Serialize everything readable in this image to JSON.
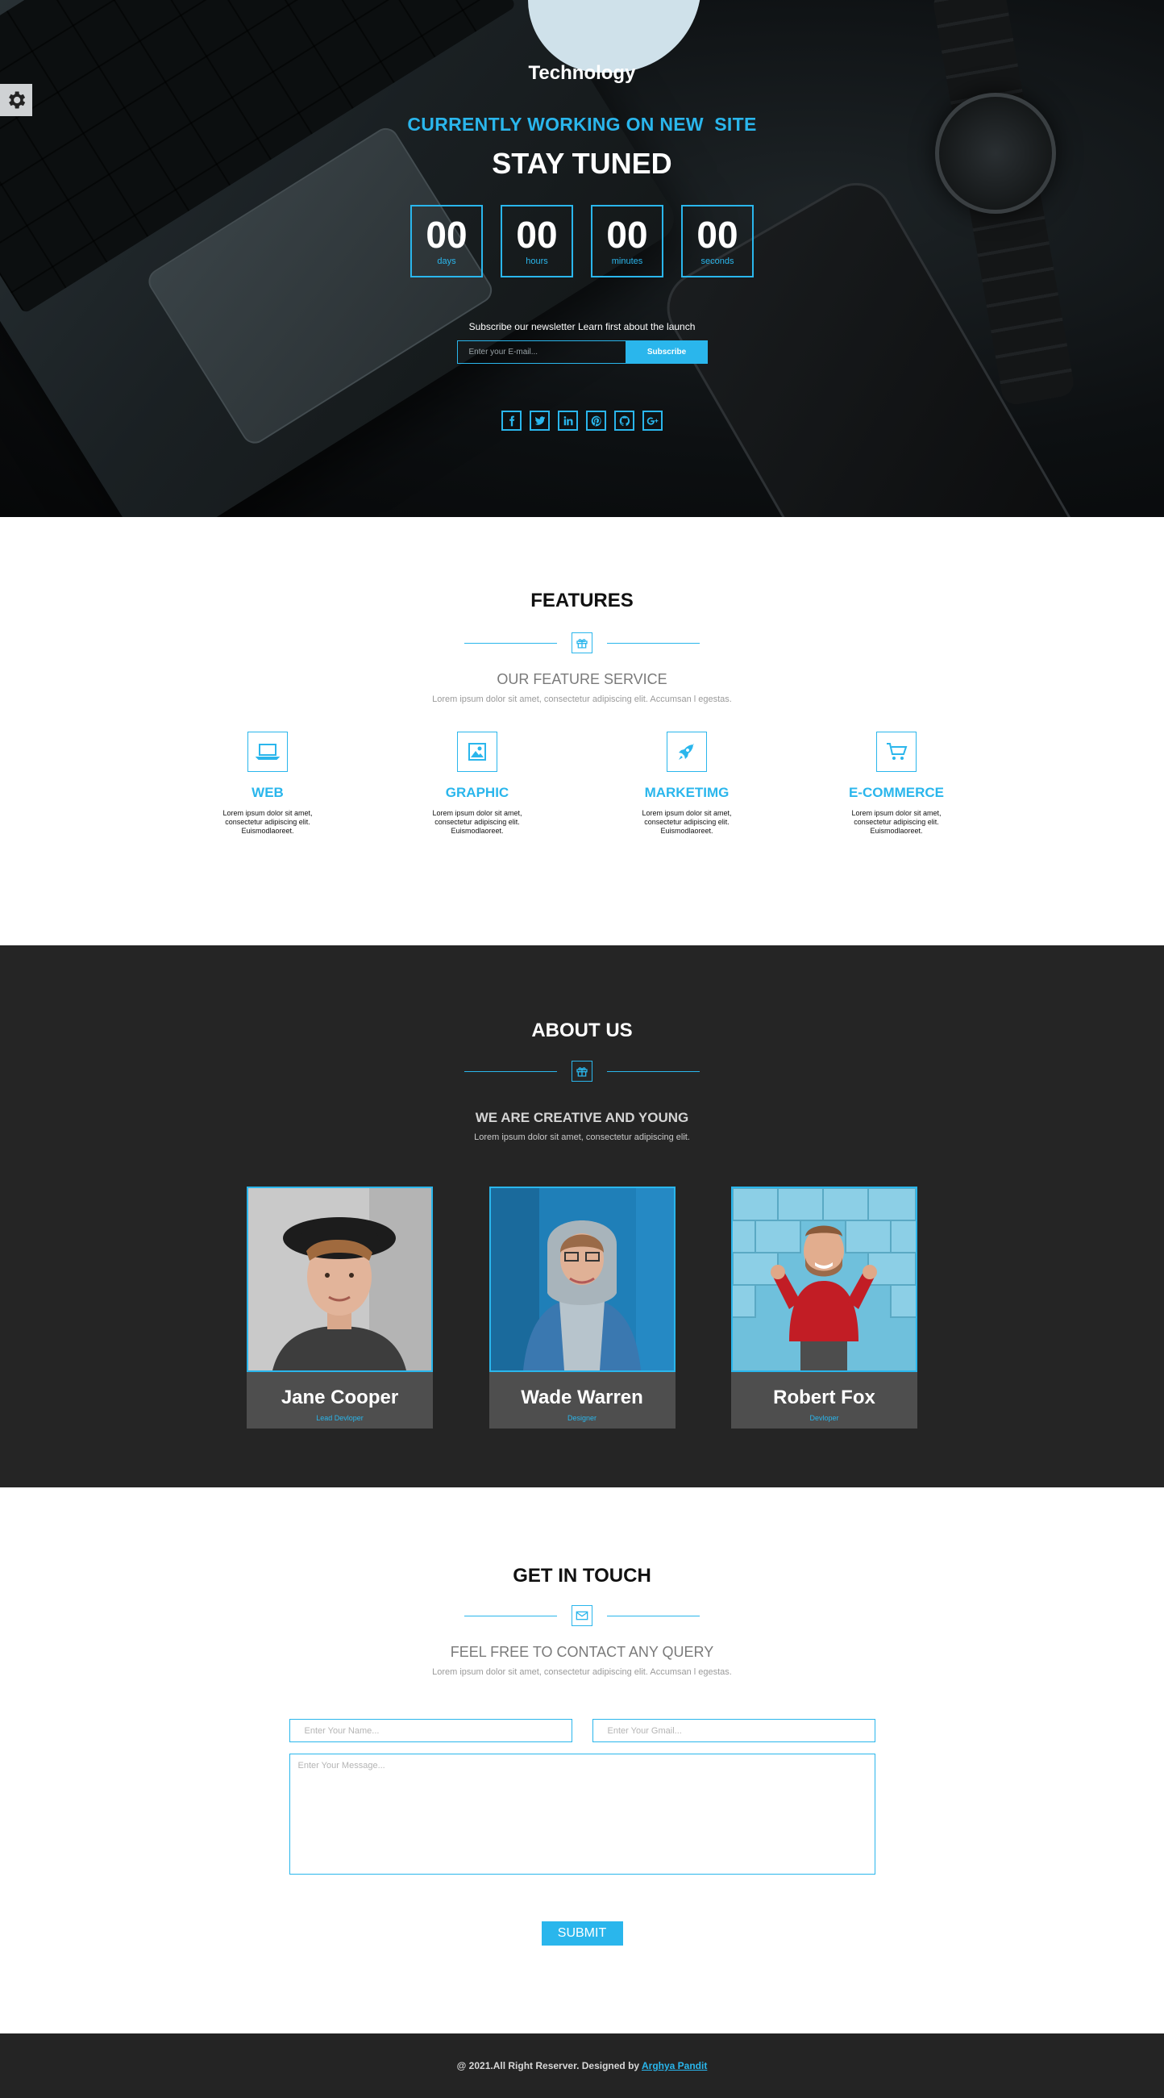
{
  "hero": {
    "brand": "Technology",
    "working": "CURRENTLY WORKING ON NEW  SITE",
    "tuned": "STAY TUNED",
    "countdown": [
      {
        "value": "00",
        "label": "days"
      },
      {
        "value": "00",
        "label": "hours"
      },
      {
        "value": "00",
        "label": "minutes"
      },
      {
        "value": "00",
        "label": "seconds"
      }
    ],
    "subscribe_text": "Subscribe our newsletter Learn first about the launch",
    "email_placeholder": "Enter your E-mail...",
    "subscribe_button": "Subscribe",
    "socials": [
      "facebook-icon",
      "twitter-icon",
      "linkedin-icon",
      "pinterest-icon",
      "github-icon",
      "google-plus-icon"
    ]
  },
  "features": {
    "title": "FEATURES",
    "sub_title": "OUR FEATURE SERVICE",
    "sub_desc": "Lorem ipsum dolor sit amet, consectetur adipiscing elit. Accumsan l egestas.",
    "items": [
      {
        "icon": "laptop-icon",
        "title": "WEB",
        "desc": "Lorem ipsum dolor sit amet, consectetur adipiscing elit. Euismodlaoreet."
      },
      {
        "icon": "image-icon",
        "title": "GRAPHIC",
        "desc": "Lorem ipsum dolor sit amet, consectetur adipiscing elit. Euismodlaoreet."
      },
      {
        "icon": "rocket-icon",
        "title": "MARKETIMG",
        "desc": "Lorem ipsum dolor sit amet, consectetur adipiscing elit. Euismodlaoreet."
      },
      {
        "icon": "cart-icon",
        "title": "E-COMMERCE",
        "desc": "Lorem ipsum dolor sit amet, consectetur adipiscing elit. Euismodlaoreet."
      }
    ]
  },
  "about": {
    "title": "ABOUT US",
    "sub_title": "WE ARE CREATIVE AND YOUNG",
    "sub_desc": "Lorem ipsum dolor sit amet, consectetur adipiscing elit.",
    "team": [
      {
        "name": "Jane Cooper",
        "role": "Lead Devloper"
      },
      {
        "name": "Wade Warren",
        "role": "Designer"
      },
      {
        "name": "Robert Fox",
        "role": "Devloper"
      }
    ]
  },
  "contact": {
    "title": "GET IN TOUCH",
    "sub_title": "FEEL FREE TO CONTACT ANY QUERY",
    "sub_desc": "Lorem ipsum dolor sit amet, consectetur adipiscing elit. Accumsan l egestas.",
    "name_placeholder": "Enter Your Name...",
    "email_placeholder": "Enter Your Gmail...",
    "message_placeholder": "Enter Your Message...",
    "submit": "SUBMIT"
  },
  "footer": {
    "copy": "@ 2021.All Right Reserver. Designed by",
    "author": "Arghya Pandit"
  },
  "colors": {
    "accent": "#2ab6ec",
    "dark_section": "#252525",
    "card": "#4e4e4e"
  }
}
